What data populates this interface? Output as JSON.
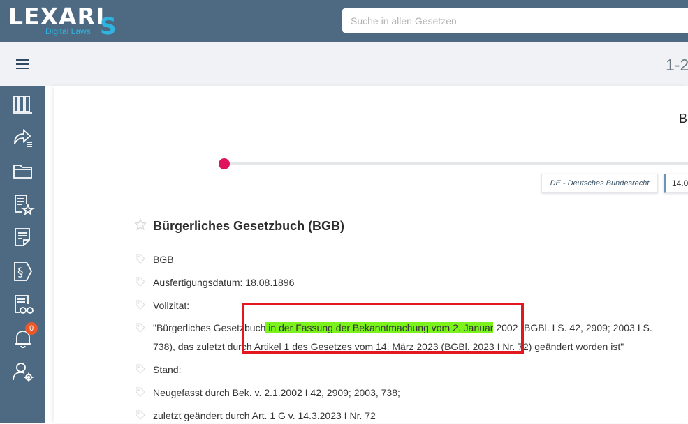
{
  "header": {
    "logo_word": "LEXARI",
    "logo_s": "S",
    "logo_sub": "Digital Laws",
    "search_placeholder": "Suche in allen Gesetzen"
  },
  "subbar": {
    "pager": "1-2"
  },
  "sidebar": {
    "items": [
      {
        "icon": "library-books-icon"
      },
      {
        "icon": "share-list-icon"
      },
      {
        "icon": "folder-icon"
      },
      {
        "icon": "favorites-document-icon"
      },
      {
        "icon": "note-document-icon"
      },
      {
        "icon": "paragraph-icon"
      },
      {
        "icon": "document-glasses-icon"
      },
      {
        "icon": "bell-icon",
        "badge": "0"
      },
      {
        "icon": "user-settings-icon"
      }
    ]
  },
  "content": {
    "heading_fragment": "B",
    "jurisdiction_chip": "DE - Deutsches Bundesrecht",
    "date_chip": "14.0",
    "doc_title": "Bürgerliches Gesetzbuch (BGB)",
    "meta": {
      "abbr": "BGB",
      "ausfertigung": "Ausfertigungsdatum: 18.08.1896",
      "vollzitat_label": "Vollzitat:",
      "vollzitat_line1_pre": "\"Bürgerliches Gesetzbuch",
      "vollzitat_line1_hl": " in der Fassung der Bekanntmachung vom 2. Januar",
      "vollzitat_line1_post": " 2002 (BGBl. I S. 42, 2909; 2003 I S.",
      "vollzitat_line2": "738), das zuletzt durch Artikel 1 des Gesetzes vom 14. März 2023 (BGBl. 2023 I Nr. 72) geändert worden ist\"",
      "stand_label": "Stand:",
      "stand_1": "Neugefasst durch Bek. v. 2.1.2002 I 42, 2909; 2003, 738;",
      "stand_2": "zuletzt geändert durch Art. 1 G v. 14.3.2023 I Nr. 72"
    }
  },
  "colors": {
    "header_bg": "#4d6a82",
    "accent_cyan": "#2fb3e0",
    "timeline_dot": "#e0145e",
    "highlight": "#7cf21c",
    "annotation_box": "#e3171e",
    "badge": "#e8582b"
  }
}
